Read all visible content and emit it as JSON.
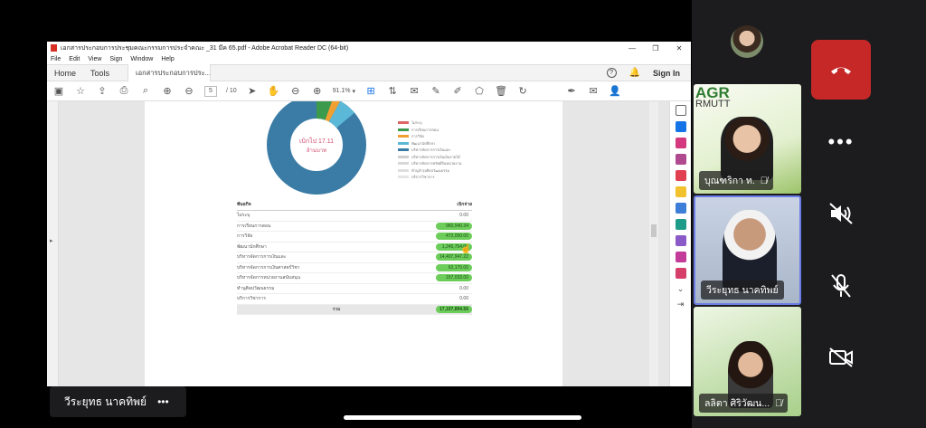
{
  "acrobat": {
    "window_title": "เอกสารประกอบการประชุมคณะกรรมการประจำคณะ _31 มีค 65.pdf - Adobe Acrobat Reader DC (64-bit)",
    "menu": [
      "File",
      "Edit",
      "View",
      "Sign",
      "Window",
      "Help"
    ],
    "nav_home": "Home",
    "nav_tools": "Tools",
    "doc_tab": "เอกสารประกอบการประ...",
    "doc_tab_close": "×",
    "sign_in": "Sign In",
    "page_current": "5",
    "page_total": "/ 10",
    "zoom": "91.1%"
  },
  "doc": {
    "donut_center_line1": "เบิกไป 17.11",
    "donut_center_line2": "ล้านบาท",
    "legend": [
      {
        "label": "ไม่ระบุ",
        "color": "#e06666"
      },
      {
        "label": "การเรียนการสอน",
        "color": "#3c9a4c"
      },
      {
        "label": "การวิจัย",
        "color": "#f0a030"
      },
      {
        "label": "พัฒนานักศึกษา",
        "color": "#5bb8d6"
      },
      {
        "label": "บริหารจัดการการเงินและ",
        "color": "#3a7ca5"
      },
      {
        "label": "บริหารจัดการการเงินเงินรายได้",
        "color": "#cfcfcf"
      },
      {
        "label": "บริหารจัดการทรัพย์สินหน่วยงาน",
        "color": "#d8d8d8"
      },
      {
        "label": "ทำนุบำรุงศิลปวัฒนธรรม",
        "color": "#dedede"
      },
      {
        "label": "บริการวิชาการ",
        "color": "#e4e4e4"
      }
    ],
    "table_head": {
      "col1": "พันธกิจ",
      "col2": "เบิกจ่าย"
    },
    "rows": [
      {
        "label": "ไม่ระบุ",
        "value": "0.00",
        "hi": false
      },
      {
        "label": "การเรียนการสอน",
        "value": "960,940.34",
        "hi": true
      },
      {
        "label": "การวิจัย",
        "value": "472,050.00",
        "hi": true
      },
      {
        "label": "พัฒนานักศึกษา",
        "value": "1,245,754.00",
        "hi": true
      },
      {
        "label": "บริหารจัดการการเงินและ",
        "value": "14,407,947.22",
        "hi": true
      },
      {
        "label": "บริหารจัดการการเงินศาสตร์วิชา",
        "value": "62,170.00",
        "hi": true
      },
      {
        "label": "บริหารจัดการหน่วยงานสนับสนุน",
        "value": "157,033.00",
        "hi": true
      },
      {
        "label": "ทำนุศิลปวัฒนธรรม",
        "value": "0.00",
        "hi": false
      },
      {
        "label": "บริการวิชาการ",
        "value": "0.00",
        "hi": false
      }
    ],
    "total_label": "รวม",
    "total_value": "17,107,894.56"
  },
  "meeting": {
    "presenter_name": "วีระยุทธ นาคทิพย์",
    "more": "•••",
    "tiles": [
      {
        "name": "บุณฑริกา ท.",
        "logo": "AGR",
        "logo2": "RMUTT"
      },
      {
        "name": "วีระยุทธ นาคทิพย์"
      },
      {
        "name": "ลลิตา ศิริวัฒน..."
      }
    ]
  }
}
